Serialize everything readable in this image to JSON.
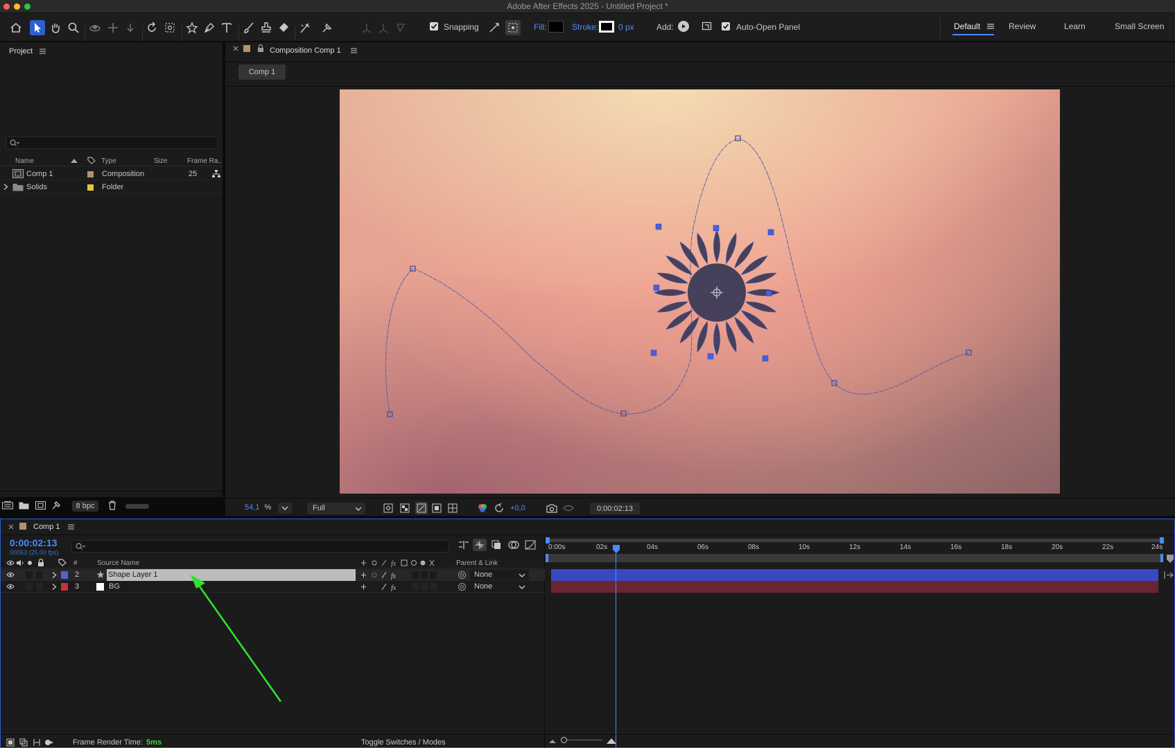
{
  "window": {
    "title": "Adobe After Effects 2025 - Untitled Project *"
  },
  "toolbar": {
    "snapping_label": "Snapping",
    "fill_label": "Fill:",
    "stroke_label": "Stroke:",
    "stroke_width": "0 px",
    "add_label": "Add:",
    "auto_open_label": "Auto-Open Panel",
    "workspaces": [
      "Default",
      "Review",
      "Learn",
      "Small Screen"
    ],
    "active_workspace": "Default"
  },
  "project": {
    "title": "Project",
    "search_placeholder": "",
    "columns": {
      "name": "Name",
      "type": "Type",
      "size": "Size",
      "frame_rate": "Frame Ra.."
    },
    "items": [
      {
        "name": "Comp 1",
        "type": "Composition",
        "size": "",
        "frame_rate": "25",
        "label_color": "#b5926a",
        "icon": "composition-icon"
      },
      {
        "name": "Solids",
        "type": "Folder",
        "size": "",
        "frame_rate": "",
        "label_color": "#e6c83a",
        "icon": "folder-icon"
      }
    ],
    "bpc": "8 bpc"
  },
  "composition": {
    "tab_title": "Composition Comp 1",
    "breadcrumb": "Comp 1",
    "zoom": "54,1",
    "zoom_unit": "%",
    "resolution": "Full",
    "exposure": "+0,0",
    "timecode": "0:00:02:13"
  },
  "timeline": {
    "tab_title": "Comp 1",
    "current_time": "0:00:02:13",
    "frame_info": "00063 (25.00 fps)",
    "columns": {
      "num": "#",
      "source": "Source Name",
      "parent": "Parent & Link"
    },
    "layers": [
      {
        "num": "2",
        "name": "Shape Layer 1",
        "label_color": "#5560d8",
        "parent": "None",
        "bar_color": "#3a48c0",
        "selected": true,
        "icon": "star-icon"
      },
      {
        "num": "3",
        "name": "BG",
        "label_color": "#c8313a",
        "parent": "None",
        "bar_color": "#6b2530",
        "selected": false,
        "icon": "solid-icon"
      }
    ],
    "ruler_labels": [
      "0:00s",
      "02s",
      "04s",
      "06s",
      "08s",
      "10s",
      "12s",
      "14s",
      "16s",
      "18s",
      "20s",
      "22s",
      "24s"
    ],
    "frame_render_label": "Frame Render Time:",
    "frame_render_value": "5ms",
    "toggle_label": "Toggle Switches / Modes"
  },
  "colors": {
    "accent": "#2d5fd0",
    "highlight": "#4a8cff",
    "annotation_arrow": "#2ee22e",
    "render_time": "#43d43a"
  }
}
